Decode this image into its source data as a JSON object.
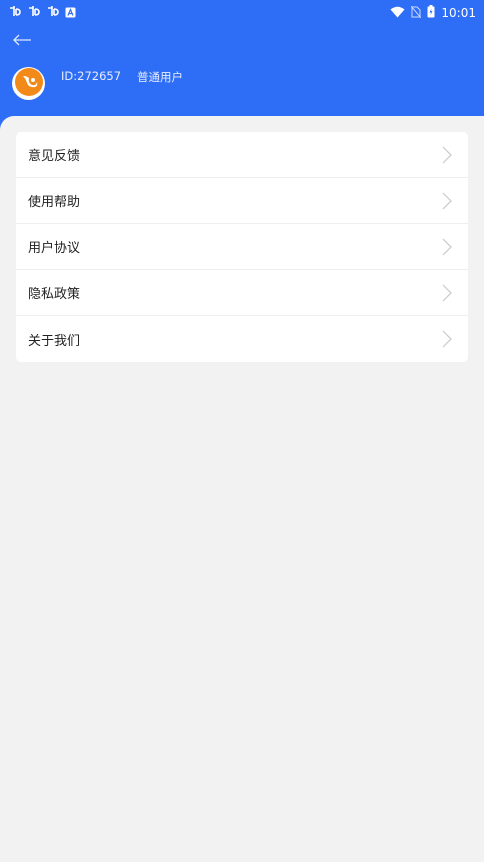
{
  "status_bar": {
    "time": "10:01",
    "left_icons": [
      "app-notification-icon",
      "app-notification-icon",
      "app-notification-icon",
      "text-a-icon"
    ],
    "right_icons": [
      "wifi-icon",
      "no-sim-icon",
      "battery-charging-icon"
    ]
  },
  "header": {
    "background_color": "#2e6ef7",
    "back_icon": "arrow-left-icon"
  },
  "profile": {
    "id_text": "ID:272657",
    "user_type": "普通用户",
    "avatar_icon": "fox-logo-icon"
  },
  "menu": {
    "items": [
      {
        "label": "意见反馈"
      },
      {
        "label": "使用帮助"
      },
      {
        "label": "用户协议"
      },
      {
        "label": "隐私政策"
      },
      {
        "label": "关于我们"
      }
    ],
    "chevron_icon": "chevron-right-icon"
  }
}
